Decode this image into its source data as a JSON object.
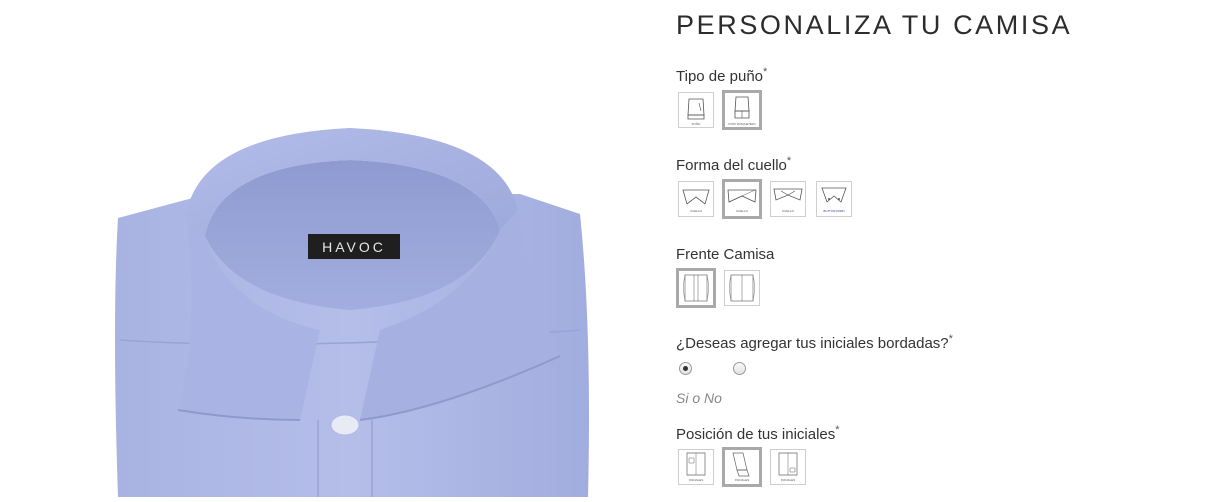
{
  "product": {
    "brand_label": "HAVOC"
  },
  "configurator": {
    "title": "PERSONALIZA TU CAMISA",
    "required_mark": "*",
    "sections": {
      "cuff": {
        "label": "Tipo de puño",
        "options": [
          {
            "icon": "cuff-simple-icon",
            "caption": "PUÑO",
            "selected": false
          },
          {
            "icon": "cuff-convertible-icon",
            "caption": "PUÑO MOSQUETERO",
            "selected": true
          }
        ]
      },
      "collar": {
        "label": "Forma del cuello",
        "options": [
          {
            "icon": "collar-classic-icon",
            "caption": "CUELLO",
            "selected": false
          },
          {
            "icon": "collar-spread-icon",
            "caption": "CUELLO",
            "selected": true
          },
          {
            "icon": "collar-cutaway-icon",
            "caption": "CUELLO",
            "selected": false
          },
          {
            "icon": "collar-button-down-icon",
            "caption": "BUTTON DOWN",
            "selected": false
          }
        ]
      },
      "front": {
        "label": "Frente Camisa",
        "options": [
          {
            "icon": "front-placket-icon",
            "caption": "",
            "selected": true
          },
          {
            "icon": "front-plain-icon",
            "caption": "",
            "selected": false
          }
        ]
      },
      "monogram": {
        "label": "¿Deseas agregar tus iniciales bordadas?",
        "options": [
          {
            "value": "Si",
            "checked": true
          },
          {
            "value": "No",
            "checked": false
          }
        ],
        "hint": "Si o No"
      },
      "monogram_position": {
        "label": "Posición de tus iniciales",
        "options": [
          {
            "icon": "initials-pocket-icon",
            "caption": "INICIALES",
            "selected": false
          },
          {
            "icon": "initials-cuff-icon",
            "caption": "INICIALES",
            "selected": true
          },
          {
            "icon": "initials-waist-icon",
            "caption": "INICIALES",
            "selected": false
          }
        ]
      }
    }
  }
}
